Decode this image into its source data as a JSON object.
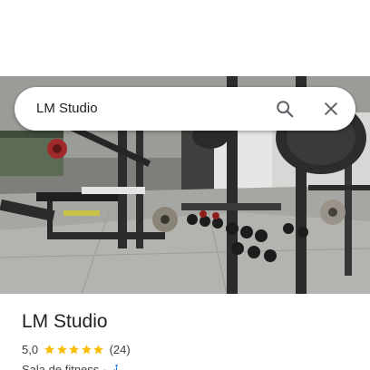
{
  "search": {
    "query": "LM Studio"
  },
  "photo": {
    "alt": "Gym interior photo"
  },
  "place": {
    "title": "LM Studio",
    "rating": "5,0",
    "stars": 5,
    "review_count": "(24)",
    "category": "Sala de fitness",
    "separator": "·"
  },
  "icons": {
    "search": "search-icon",
    "close": "close-icon",
    "star": "star-icon",
    "accessibility": "wheelchair-accessible-icon"
  },
  "colors": {
    "star": "#fbbc04",
    "accessibility": "#1a73e8",
    "text_primary": "#202124",
    "text_secondary": "#3c4043",
    "icon": "#5f6368"
  }
}
